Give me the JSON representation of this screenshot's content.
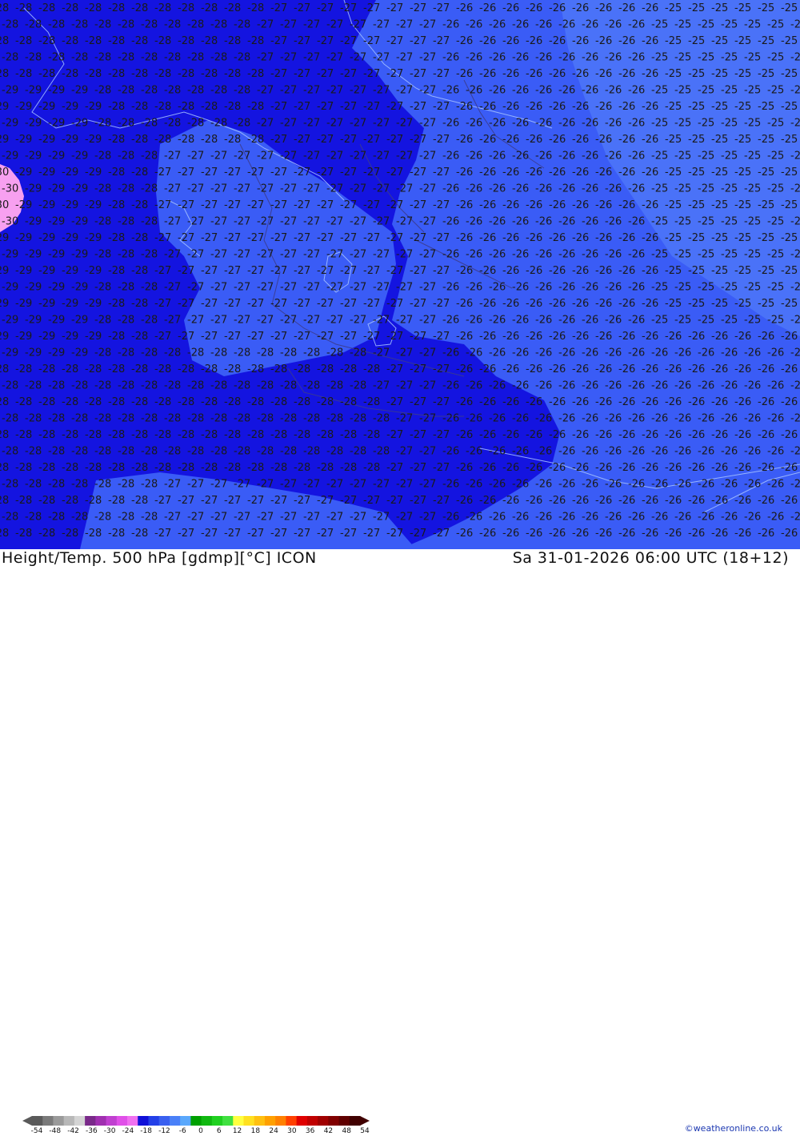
{
  "title": "Height/Temp. 500 hPa [gdmp][°C] ICON",
  "valid_time": "Sa 31-01-2026 06:00 UTC (18+12)",
  "credit": "©weatheronline.co.uk",
  "colors": {
    "band_minus30": "#f7a0f0",
    "band_minus29_28": "#1414e0",
    "band_minus27_26": "#3a5cf6",
    "band_minus25": "#4a72f8",
    "border_color": "#3c3c8c",
    "coast_color": "#a8c4ff",
    "label_color": "#1a1a1a"
  },
  "legend": {
    "ticks": [
      "-54",
      "-48",
      "-42",
      "-36",
      "-30",
      "-24",
      "-18",
      "-12",
      "-6",
      "0",
      "6",
      "12",
      "18",
      "24",
      "30",
      "36",
      "42",
      "48",
      "54"
    ],
    "swatches": [
      "#5a5a5a",
      "#7a7a7a",
      "#9a9a9a",
      "#b8b8b8",
      "#d4d4d4",
      "#7a2a8a",
      "#a030b0",
      "#c040d0",
      "#e050e8",
      "#f070f0",
      "#1010d8",
      "#2440e8",
      "#3a60f0",
      "#4a80f8",
      "#5aa8fc",
      "#00a000",
      "#10b810",
      "#20d020",
      "#40e040",
      "#ffff40",
      "#ffe020",
      "#ffc010",
      "#ffa000",
      "#ff8000",
      "#ff4000",
      "#e00000",
      "#c00000",
      "#a00000",
      "#800000",
      "#600000",
      "#400000"
    ]
  },
  "map_labels": {
    "values": [
      "-30",
      "-29",
      "-28",
      "-27",
      "-26",
      "-25"
    ]
  }
}
